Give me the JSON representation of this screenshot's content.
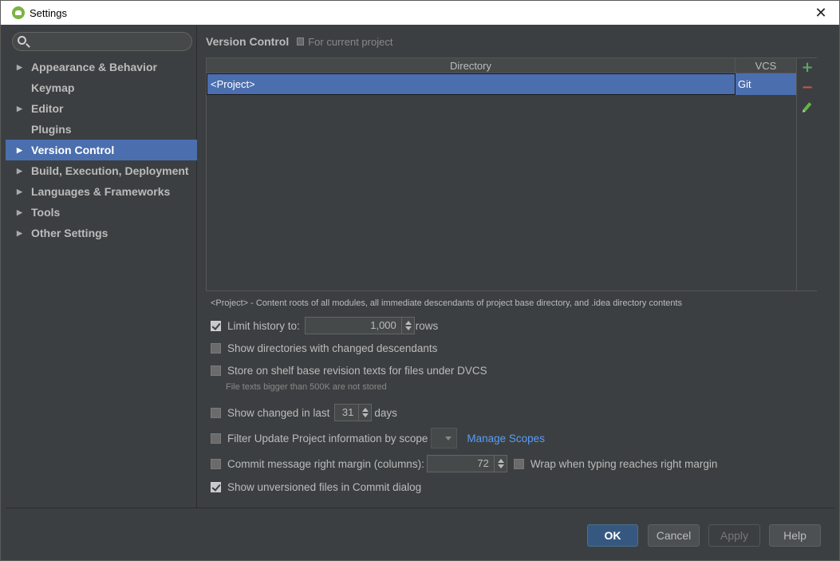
{
  "window": {
    "title": "Settings",
    "close_glyph": "✕"
  },
  "search": {
    "placeholder": "",
    "value": ""
  },
  "sidebar": {
    "items": [
      {
        "label": "Appearance & Behavior",
        "expandable": true,
        "selected": false
      },
      {
        "label": "Keymap",
        "expandable": false,
        "selected": false
      },
      {
        "label": "Editor",
        "expandable": true,
        "selected": false
      },
      {
        "label": "Plugins",
        "expandable": false,
        "selected": false
      },
      {
        "label": "Version Control",
        "expandable": true,
        "selected": true
      },
      {
        "label": "Build, Execution, Deployment",
        "expandable": true,
        "selected": false
      },
      {
        "label": "Languages & Frameworks",
        "expandable": true,
        "selected": false
      },
      {
        "label": "Tools",
        "expandable": true,
        "selected": false
      },
      {
        "label": "Other Settings",
        "expandable": true,
        "selected": false
      }
    ],
    "arrow_glyph": "▶"
  },
  "main": {
    "title": "Version Control",
    "scope_note": "For current project",
    "table": {
      "columns": [
        "Directory",
        "VCS"
      ],
      "rows": [
        {
          "directory": "<Project>",
          "vcs": "Git"
        }
      ]
    },
    "toolbar": {
      "add": "+",
      "remove": "−"
    },
    "note": "<Project> - Content roots of all modules, all immediate descendants of project base directory, and .idea directory contents",
    "options": {
      "limit_history": {
        "label": "Limit history to:",
        "checked": true,
        "value": "1,000",
        "suffix": "rows"
      },
      "show_dirs": {
        "label": "Show directories with changed descendants",
        "checked": false
      },
      "store_shelf": {
        "label": "Store on shelf base revision texts for files under DVCS",
        "checked": false,
        "sub_note": "File texts bigger than 500K are not stored"
      },
      "show_changed": {
        "label": "Show changed in last",
        "checked": false,
        "value": "31",
        "suffix": "days"
      },
      "filter_update": {
        "label": "Filter Update Project information by scope",
        "checked": false,
        "link": "Manage Scopes"
      },
      "commit_margin": {
        "label": "Commit message right margin (columns):",
        "checked": false,
        "value": "72",
        "wrap_label": "Wrap when typing reaches right margin",
        "wrap_checked": false
      },
      "show_unversioned": {
        "label": "Show unversioned files in Commit dialog",
        "checked": true
      }
    }
  },
  "buttons": {
    "ok": "OK",
    "cancel": "Cancel",
    "apply": "Apply",
    "help": "Help"
  },
  "colors": {
    "selection": "#4b6eaf",
    "background": "#3c3f41",
    "link": "#589df6",
    "add": "#59a869",
    "remove": "#c75450"
  }
}
